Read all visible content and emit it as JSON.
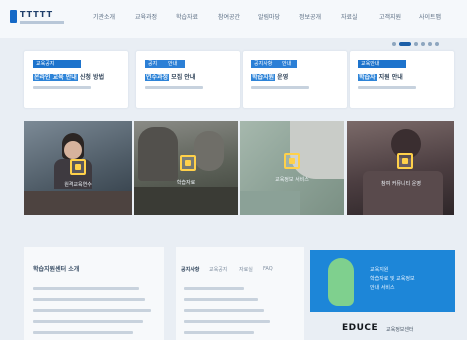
{
  "header": {
    "logo_text": "TTTTT",
    "nav": [
      "기관소개",
      "교육과정",
      "학습자료",
      "참여공간",
      "알림마당",
      "정보공개",
      "자료실",
      "고객지원",
      "사이트맵"
    ]
  },
  "notice_cards": [
    {
      "badge": "교육공지",
      "title_highlight": "온라인 교육 안내",
      "title_rest": " 신청 방법",
      "wide": true
    },
    {
      "badge": "공지",
      "badge2": "안내",
      "title_highlight": "연수과정",
      "title_rest": " 모집 안내"
    },
    {
      "badge": "공지사항",
      "badge2": "안내",
      "title_highlight": "학습지원",
      "title_rest": " 운영"
    },
    {
      "badge": "교육안내",
      "title_highlight": "학습자",
      "title_rest": " 지원 안내",
      "wide": true
    }
  ],
  "tiles": [
    {
      "label": "원격교육연수"
    },
    {
      "label": "학습자료"
    },
    {
      "label": "교육정보 서비스"
    },
    {
      "label": "참여 커뮤니티 운영"
    }
  ],
  "bottom": {
    "notice_title": "학습지원센터 소개",
    "tabs": [
      "공지사항",
      "교육공지",
      "자료실",
      "FAQ"
    ],
    "banner_lines": [
      "교육지원",
      "학습자료 및 교육정보",
      "안내 서비스"
    ],
    "partner_logo": "EDUCE",
    "partner_sub": "교육정보센터"
  },
  "colors": {
    "brand": "#1569c7",
    "accent": "#2b7fd6",
    "banner": "#1d86d8"
  }
}
